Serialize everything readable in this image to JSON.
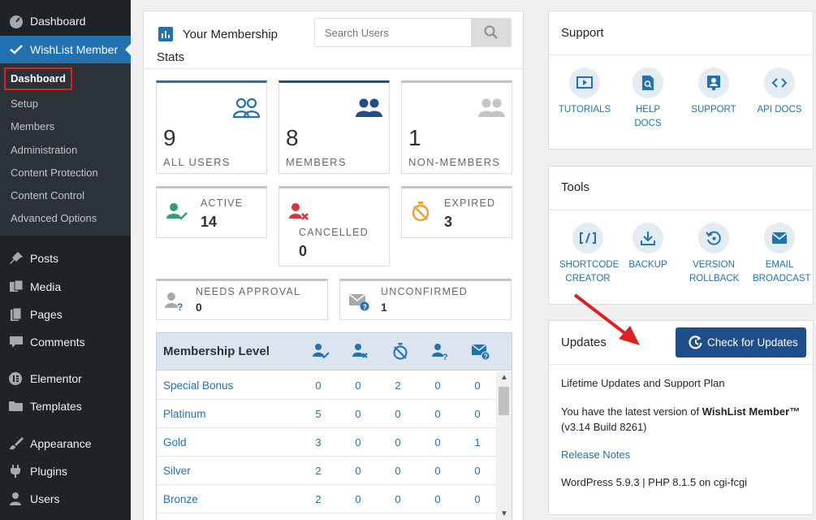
{
  "sidebar": {
    "top_items": [
      {
        "label": "Dashboard",
        "icon": "dashboard-icon"
      },
      {
        "label": "WishList Member",
        "icon": "check-icon"
      }
    ],
    "submenu": [
      "Dashboard",
      "Setup",
      "Members",
      "Administration",
      "Content Protection",
      "Content Control",
      "Advanced Options"
    ],
    "items": [
      {
        "label": "Posts",
        "icon": "pin-icon"
      },
      {
        "label": "Media",
        "icon": "media-icon"
      },
      {
        "label": "Pages",
        "icon": "pages-icon"
      },
      {
        "label": "Comments",
        "icon": "comment-icon"
      },
      {
        "label": "Elementor",
        "icon": "elementor-icon"
      },
      {
        "label": "Templates",
        "icon": "folder-icon"
      },
      {
        "label": "Appearance",
        "icon": "brush-icon"
      },
      {
        "label": "Plugins",
        "icon": "plug-icon"
      },
      {
        "label": "Users",
        "icon": "user-icon"
      }
    ]
  },
  "stats": {
    "title": "Your Membership Stats",
    "search_placeholder": "Search Users",
    "cards": [
      {
        "value": "9",
        "label": "ALL USERS"
      },
      {
        "value": "8",
        "label": "MEMBERS"
      },
      {
        "value": "1",
        "label": "NON-MEMBERS"
      }
    ],
    "status": [
      {
        "label": "ACTIVE",
        "value": "14"
      },
      {
        "label": "CANCELLED",
        "value": "0"
      },
      {
        "label": "EXPIRED",
        "value": "3"
      }
    ],
    "pending": [
      {
        "label": "NEEDS APPROVAL",
        "value": "0"
      },
      {
        "label": "UNCONFIRMED",
        "value": "1"
      }
    ],
    "table": {
      "header": "Membership Level",
      "rows": [
        {
          "level": "Special Bonus",
          "values": [
            "0",
            "0",
            "2",
            "0",
            "0"
          ]
        },
        {
          "level": "Platinum",
          "values": [
            "5",
            "0",
            "0",
            "0",
            "0"
          ]
        },
        {
          "level": "Gold",
          "values": [
            "3",
            "0",
            "0",
            "0",
            "1"
          ]
        },
        {
          "level": "Silver",
          "values": [
            "2",
            "0",
            "0",
            "0",
            "0"
          ]
        },
        {
          "level": "Bronze",
          "values": [
            "2",
            "0",
            "0",
            "0",
            "0"
          ]
        }
      ]
    }
  },
  "support": {
    "title": "Support",
    "items": [
      {
        "label": "TUTORIALS",
        "icon": "video-icon"
      },
      {
        "label": "HELP DOCS",
        "icon": "doc-search-icon"
      },
      {
        "label": "SUPPORT",
        "icon": "support-icon"
      },
      {
        "label": "API DOCS",
        "icon": "code-icon"
      }
    ]
  },
  "tools": {
    "title": "Tools",
    "items": [
      {
        "label": "SHORTCODE CREATOR",
        "icon": "shortcode-icon"
      },
      {
        "label": "BACKUP",
        "icon": "download-icon"
      },
      {
        "label": "VERSION ROLLBACK",
        "icon": "rollback-icon"
      },
      {
        "label": "EMAIL BROADCAST",
        "icon": "mail-icon"
      }
    ]
  },
  "updates": {
    "title": "Updates",
    "button": "Check for Updates",
    "plan": "Lifetime Updates and Support Plan",
    "latest_prefix": "You have the latest version of ",
    "product": "WishList Member™",
    "version": "(v3.14 Build 8261)",
    "release_notes": "Release Notes",
    "env": "WordPress 5.9.3 | PHP 8.1.5 on cgi-fcgi"
  },
  "colors": {
    "accent": "#2271b1",
    "button": "#1e4f8a",
    "sidebar": "#1d2327",
    "active_green": "#2ea06b",
    "cancel_red": "#d63638",
    "expired_orange": "#f0a030"
  }
}
